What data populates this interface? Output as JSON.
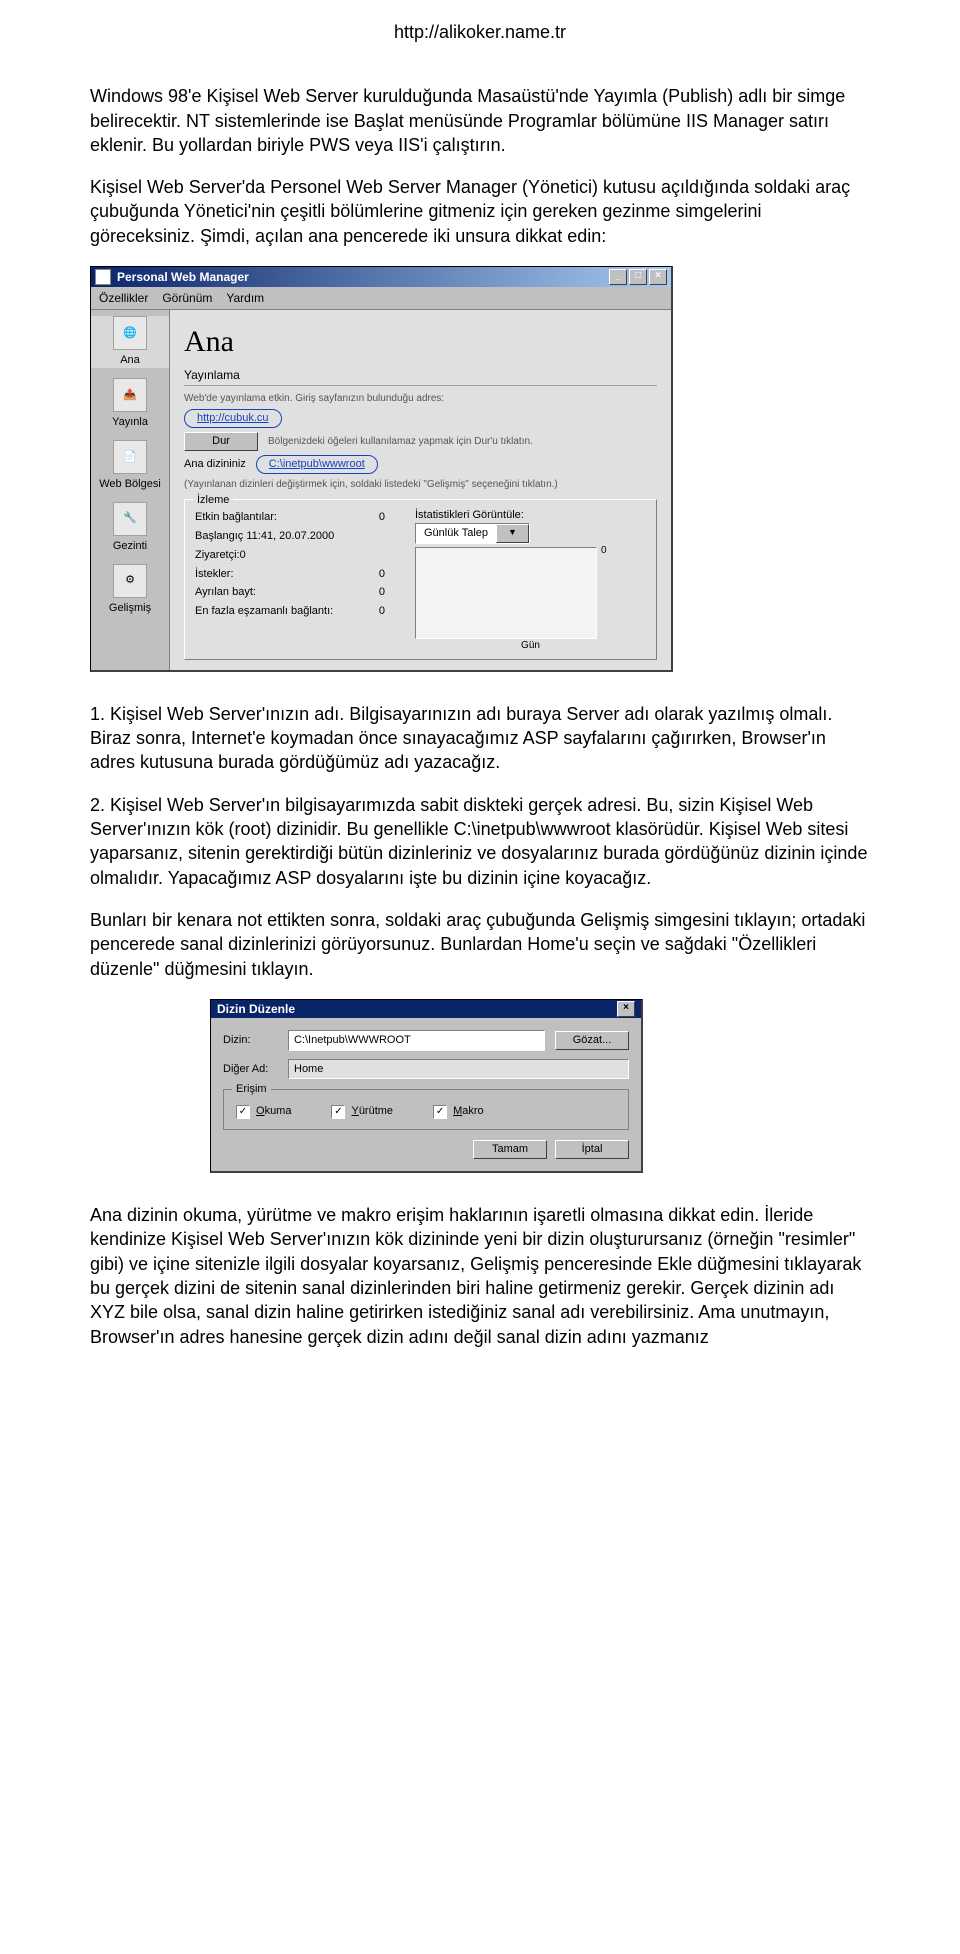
{
  "header_url": "http://alikoker.name.tr",
  "para1": "Windows 98'e Kişisel Web Server kurulduğunda Masaüstü'nde Yayımla (Publish) adlı bir simge belirecektir. NT sistemlerinde ise Başlat menüsünde Programlar bölümüne IIS Manager satırı eklenir. Bu yollardan biriyle PWS veya IIS'i çalıştırın.",
  "para2": "Kişisel Web Server'da Personel Web Server Manager (Yönetici) kutusu açıldığında soldaki araç çubuğunda Yönetici'nin çeşitli bölümlerine gitmeniz için gereken gezinme simgelerini göreceksiniz. Şimdi, açılan ana pencerede iki unsura dikkat edin:",
  "pwm": {
    "title": "Personal Web Manager",
    "menu": {
      "m1": "Özellikler",
      "m2": "Görünüm",
      "m3": "Yardım"
    },
    "side": {
      "ana": "Ana",
      "yayinla": "Yayınla",
      "webbolgesi": "Web Bölgesi",
      "gezinti": "Gezinti",
      "gelismis": "Gelişmiş"
    },
    "main": {
      "heading": "Ana",
      "sec_pub": "Yayınlama",
      "pub_text": "Web'de yayınlama etkin. Giriş sayfanızın bulunduğu adres:",
      "url": "http://cubuk.cu",
      "stop_btn": "Dur",
      "stop_hint": "Bölgenizdeki öğeleri kullanılamaz yapmak için Dur'u tıklatın.",
      "home_dir_label": "Ana dizininiz",
      "home_dir": "C:\\inetpub\\wwwroot",
      "home_hint": "(Yayınlanan dizinleri değiştirmek için, soldaki listedeki \"Gelişmiş\" seçeneğini tıklatın.)",
      "sec_monitor": "İzleme",
      "stats_title": "İstatistikleri Görüntüle:",
      "stats_combo": "Günlük Talep",
      "r1_label": "Etkin bağlantılar:",
      "r1_val": "0",
      "r2_label": "Başlangıç 11:41, 20.07.2000",
      "r3_label": "Ziyaretçi:0",
      "r4_label": "İstekler:",
      "r4_val": "0",
      "r5_label": "Ayrılan bayt:",
      "r5_val": "0",
      "r6_label": "En fazla eşzamanlı bağlantı:",
      "r6_val": "0",
      "axis_right": "0",
      "axis_bottom": "Gün"
    }
  },
  "para3": "1. Kişisel Web Server'ınızın adı. Bilgisayarınızın adı buraya Server adı olarak yazılmış olmalı. Biraz sonra, Internet'e koymadan önce sınayacağımız ASP sayfalarını çağırırken, Browser'ın adres kutusuna burada gördüğümüz adı yazacağız.",
  "para4": "2. Kişisel Web Server'ın bilgisayarımızda sabit diskteki gerçek adresi. Bu, sizin Kişisel Web Server'ınızın kök (root) dizinidir. Bu genellikle C:\\inetpub\\wwwroot klasörüdür. Kişisel Web sitesi yaparsanız, sitenin gerektirdiği bütün dizinleriniz ve dosyalarınız burada gördüğünüz dizinin içinde olmalıdır. Yapacağımız ASP dosyalarını işte bu dizinin içine koyacağız.",
  "para5": "Bunları bir kenara not ettikten sonra, soldaki araç çubuğunda Gelişmiş simgesini tıklayın; ortadaki pencerede sanal dizinlerinizi görüyorsunuz. Bunlardan Home'u seçin ve sağdaki \"Özellikleri düzenle\" düğmesini tıklayın.",
  "dlg2": {
    "title": "Dizin Düzenle",
    "dir_label": "Dizin:",
    "dir_value": "C:\\Inetpub\\WWWROOT",
    "browse": "Gözat...",
    "alias_label": "Diğer Ad:",
    "alias_value": "Home",
    "access_label": "Erişim",
    "chk_read_pre": "O",
    "chk_read": "kuma",
    "chk_exec_pre": "Y",
    "chk_exec": "ürütme",
    "chk_macro_pre": "M",
    "chk_macro": "akro",
    "ok": "Tamam",
    "cancel": "İptal"
  },
  "para6": "Ana dizinin okuma, yürütme ve makro erişim haklarının işaretli olmasına dikkat edin. İleride kendinize Kişisel Web Server'ınızın kök dizininde yeni bir dizin oluşturursanız (örneğin \"resimler\" gibi) ve içine sitenizle ilgili dosyalar koyarsanız, Gelişmiş penceresinde Ekle düğmesini tıklayarak bu gerçek dizini de sitenin sanal dizinlerinden biri haline getirmeniz gerekir. Gerçek dizinin adı XYZ bile olsa, sanal dizin haline getirirken istediğiniz sanal adı verebilirsiniz. Ama unutmayın, Browser'ın adres hanesine gerçek dizin adını değil sanal dizin adını yazmanız"
}
